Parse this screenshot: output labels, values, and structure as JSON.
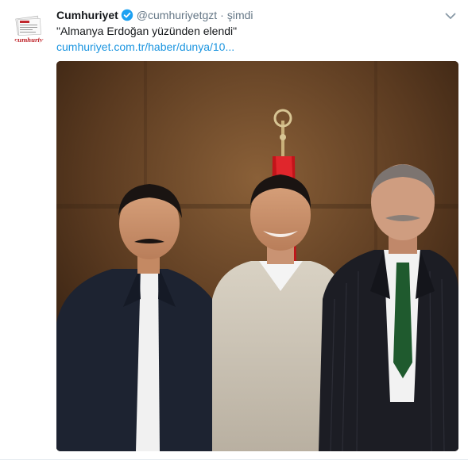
{
  "tweet": {
    "author_name": "Cumhuriyet",
    "screen_name": "@cumhuriyetgzt",
    "separator": "·",
    "time": "şimdi",
    "text": "\"Almanya Erdoğan yüzünden elendi\"",
    "link": "cumhuriyet.com.tr/haber/dunya/10...",
    "avatar_logo": "cumhuriyet",
    "verified": true
  },
  "icons": {
    "verified": "verified-badge-icon",
    "more": "chevron-down-icon"
  },
  "colors": {
    "name": "#14171a",
    "secondary": "#657786",
    "link": "#1b95e0",
    "verified": "#1da1f2",
    "brand_red": "#c0272d"
  }
}
